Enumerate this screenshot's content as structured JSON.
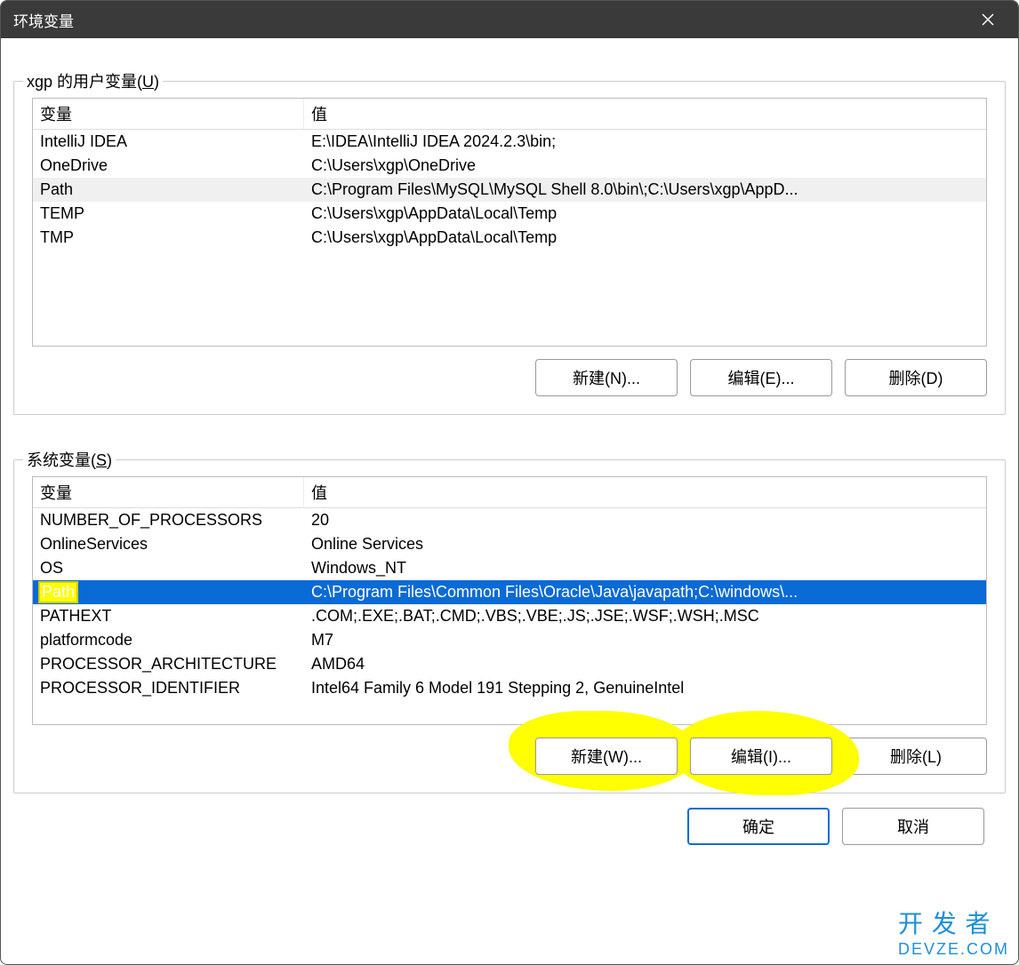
{
  "window_title": "环境变量",
  "user_group_label_prefix": "xgp 的用户变量(",
  "user_group_hotkey": "U",
  "user_group_label_suffix": ")",
  "sys_group_label_prefix": "系统变量(",
  "sys_group_hotkey": "S",
  "sys_group_label_suffix": ")",
  "columns": {
    "name": "变量",
    "value": "值"
  },
  "user_vars": [
    {
      "name": "IntelliJ IDEA",
      "value": "E:\\IDEA\\IntelliJ IDEA 2024.2.3\\bin;",
      "selected": false
    },
    {
      "name": "OneDrive",
      "value": "C:\\Users\\xgp\\OneDrive",
      "selected": false
    },
    {
      "name": "Path",
      "value": "C:\\Program Files\\MySQL\\MySQL Shell 8.0\\bin\\;C:\\Users\\xgp\\AppD...",
      "selected": true
    },
    {
      "name": "TEMP",
      "value": "C:\\Users\\xgp\\AppData\\Local\\Temp",
      "selected": false
    },
    {
      "name": "TMP",
      "value": "C:\\Users\\xgp\\AppData\\Local\\Temp",
      "selected": false
    }
  ],
  "sys_vars": [
    {
      "name": "NUMBER_OF_PROCESSORS",
      "value": "20",
      "selected": false,
      "highlighted": false
    },
    {
      "name": "OnlineServices",
      "value": "Online Services",
      "selected": false,
      "highlighted": false
    },
    {
      "name": "OS",
      "value": "Windows_NT",
      "selected": false,
      "highlighted": false
    },
    {
      "name": "Path",
      "value": "C:\\Program Files\\Common Files\\Oracle\\Java\\javapath;C:\\windows\\...",
      "selected": true,
      "highlighted": true
    },
    {
      "name": "PATHEXT",
      "value": ".COM;.EXE;.BAT;.CMD;.VBS;.VBE;.JS;.JSE;.WSF;.WSH;.MSC",
      "selected": false,
      "highlighted": false
    },
    {
      "name": "platformcode",
      "value": "M7",
      "selected": false,
      "highlighted": false
    },
    {
      "name": "PROCESSOR_ARCHITECTURE",
      "value": "AMD64",
      "selected": false,
      "highlighted": false
    },
    {
      "name": "PROCESSOR_IDENTIFIER",
      "value": "Intel64 Family 6 Model 191 Stepping 2, GenuineIntel",
      "selected": false,
      "highlighted": false
    }
  ],
  "buttons": {
    "user_new": "新建(N)...",
    "user_edit": "编辑(E)...",
    "user_delete": "删除(D)",
    "sys_new": "新建(W)...",
    "sys_edit": "编辑(I)...",
    "sys_delete": "删除(L)",
    "ok": "确定",
    "cancel": "取消"
  },
  "watermark": {
    "line1": "开 发 者",
    "line2": "DEVZE.COM"
  }
}
